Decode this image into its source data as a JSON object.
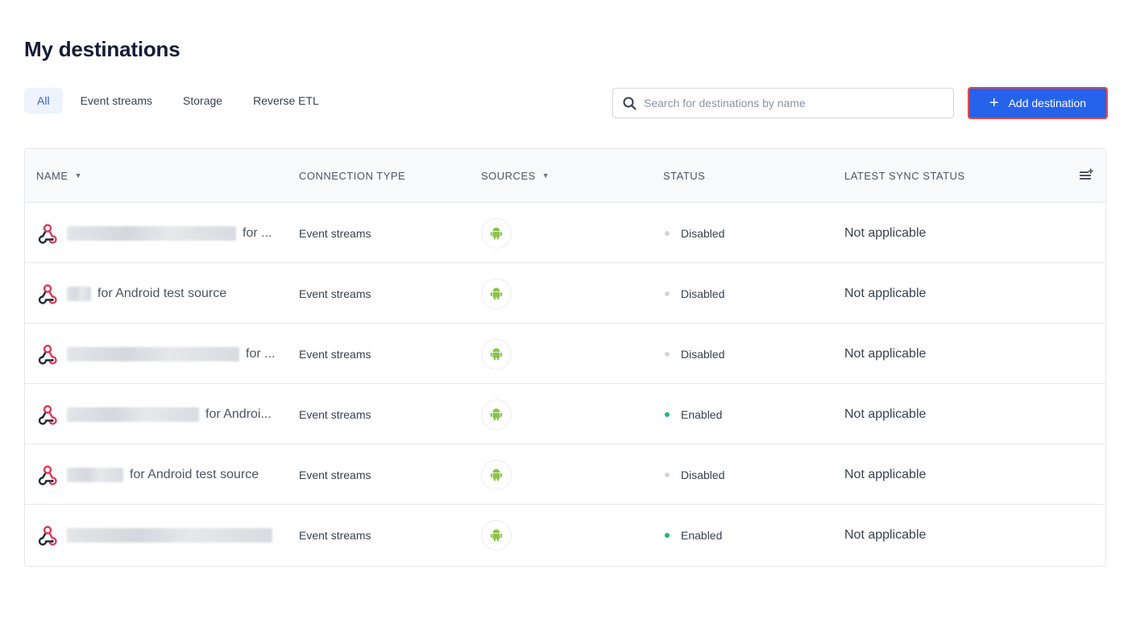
{
  "page": {
    "title": "My destinations"
  },
  "tabs": [
    {
      "label": "All",
      "active": true
    },
    {
      "label": "Event streams",
      "active": false
    },
    {
      "label": "Storage",
      "active": false
    },
    {
      "label": "Reverse ETL",
      "active": false
    }
  ],
  "search": {
    "placeholder": "Search for destinations by name",
    "value": ""
  },
  "add_button": {
    "label": "Add destination",
    "icon": "plus-icon"
  },
  "colors": {
    "accent": "#2563eb",
    "highlight_border": "#e5484d",
    "enabled": "#22b573",
    "disabled": "#d1d5db",
    "android": "#8bc34a",
    "webhook": "#d93a57"
  },
  "table": {
    "columns": {
      "name": "NAME",
      "connection_type": "CONNECTION TYPE",
      "sources": "SOURCES",
      "status": "STATUS",
      "latest_sync_status": "LATEST SYNC STATUS"
    },
    "rows": [
      {
        "name_visible": "for ...",
        "connection_type": "Event streams",
        "source_icon": "android-icon",
        "status": "Disabled",
        "sync": "Not applicable"
      },
      {
        "name_visible": "for Android test source",
        "connection_type": "Event streams",
        "source_icon": "android-icon",
        "status": "Disabled",
        "sync": "Not applicable"
      },
      {
        "name_visible": "for ...",
        "connection_type": "Event streams",
        "source_icon": "android-icon",
        "status": "Disabled",
        "sync": "Not applicable"
      },
      {
        "name_visible": "for Androi...",
        "connection_type": "Event streams",
        "source_icon": "android-icon",
        "status": "Enabled",
        "sync": "Not applicable"
      },
      {
        "name_visible": "for Android test source",
        "connection_type": "Event streams",
        "source_icon": "android-icon",
        "status": "Disabled",
        "sync": "Not applicable"
      },
      {
        "name_visible": "",
        "connection_type": "Event streams",
        "source_icon": "android-icon",
        "status": "Enabled",
        "sync": "Not applicable"
      }
    ]
  }
}
